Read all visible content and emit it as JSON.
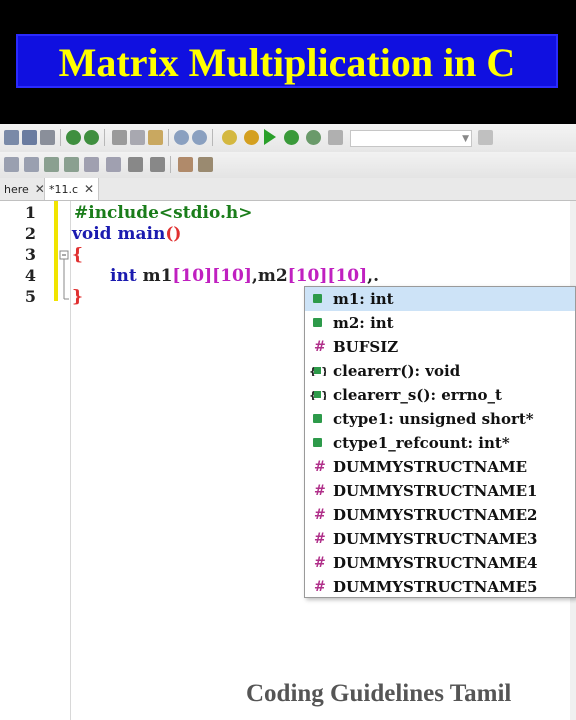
{
  "banner": {
    "title": "Matrix Multiplication in C",
    "bg_color": "#000000",
    "box_color": "#1010e0",
    "text_color": "#ffff00"
  },
  "toolbar": {
    "row1_icons": [
      "save-icon",
      "save-all-icon",
      "print-icon",
      "undo-icon",
      "redo-icon",
      "cut-icon",
      "copy-icon",
      "paste-icon",
      "find-icon",
      "replace-icon",
      "build-settings-icon",
      "run-icon",
      "build-run-icon",
      "debug-icon",
      "abort-icon",
      "select-target-icon"
    ],
    "row2_icons": [
      "jump-icon",
      "jump-back-icon",
      "jump-forward-icon",
      "bookmark-icon",
      "bookmark-prev-icon",
      "bookmark-next-icon",
      "toggle-icon",
      "pause-icon",
      "stop-icon",
      "zoom-fit-icon",
      "help-icon"
    ]
  },
  "tabs": [
    {
      "label": "here",
      "active": false
    },
    {
      "label": "*11.c",
      "active": true
    }
  ],
  "editor": {
    "line_numbers": [
      "1",
      "2",
      "3",
      "4",
      "5"
    ],
    "line1": "#include<stdio.h>",
    "line2_kw": "void",
    "line2_name": " main",
    "line2_paren": "()",
    "line3": "{",
    "line4_kw": "int",
    "line4_var1": " m1",
    "line4_dims1a": "[10]",
    "line4_dims1b": "[10]",
    "line4_comma": ",",
    "line4_var2": "m2",
    "line4_dims2a": "[10]",
    "line4_dims2b": "[10]",
    "line4_tail": ",.",
    "line5": "}"
  },
  "autocomplete": {
    "items": [
      {
        "kind": "variable",
        "label": "m1: int",
        "selected": true
      },
      {
        "kind": "variable",
        "label": "m2: int",
        "selected": false
      },
      {
        "kind": "macro",
        "label": "BUFSIZ",
        "selected": false
      },
      {
        "kind": "function",
        "label": "clearerr(): void",
        "selected": false
      },
      {
        "kind": "function",
        "label": "clearerr_s(): errno_t",
        "selected": false
      },
      {
        "kind": "variable",
        "label": "ctype1: unsigned short*",
        "selected": false
      },
      {
        "kind": "variable",
        "label": "ctype1_refcount: int*",
        "selected": false
      },
      {
        "kind": "macro",
        "label": "DUMMYSTRUCTNAME",
        "selected": false
      },
      {
        "kind": "macro",
        "label": "DUMMYSTRUCTNAME1",
        "selected": false
      },
      {
        "kind": "macro",
        "label": "DUMMYSTRUCTNAME2",
        "selected": false
      },
      {
        "kind": "macro",
        "label": "DUMMYSTRUCTNAME3",
        "selected": false
      },
      {
        "kind": "macro",
        "label": "DUMMYSTRUCTNAME4",
        "selected": false
      },
      {
        "kind": "macro",
        "label": "DUMMYSTRUCTNAME5",
        "selected": false
      }
    ]
  },
  "watermark": "Coding Guidelines Tamil"
}
